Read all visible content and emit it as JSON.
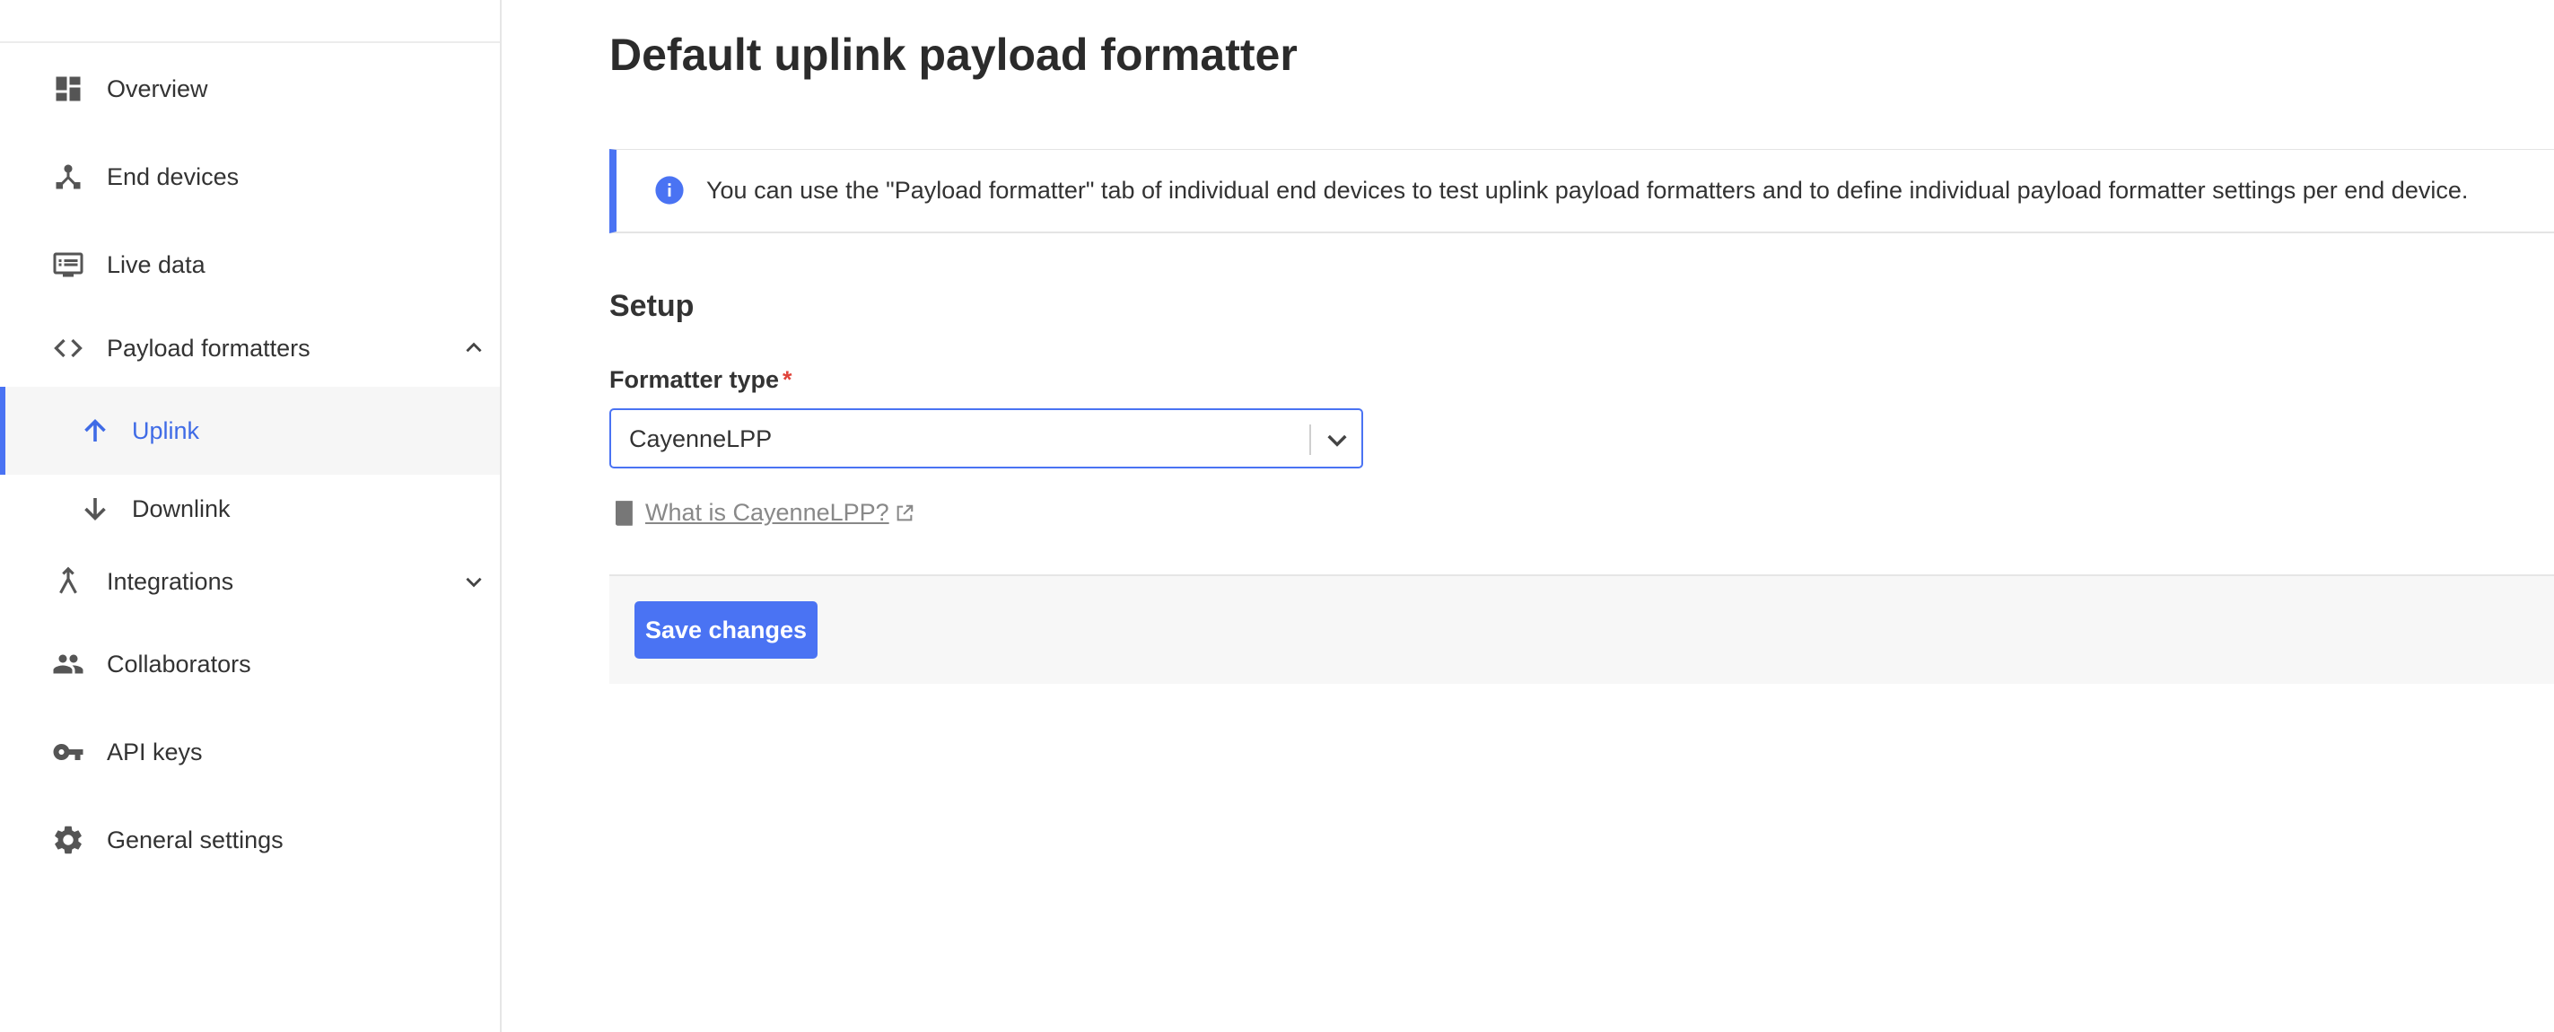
{
  "sidebar": {
    "items": [
      {
        "label": "Overview",
        "icon": "dashboard-icon"
      },
      {
        "label": "End devices",
        "icon": "device-hub-icon"
      },
      {
        "label": "Live data",
        "icon": "live-data-icon"
      },
      {
        "label": "Payload formatters",
        "icon": "code-icon",
        "expanded": true
      },
      {
        "label": "Uplink",
        "icon": "arrow-up-icon",
        "active": true
      },
      {
        "label": "Downlink",
        "icon": "arrow-down-icon"
      },
      {
        "label": "Integrations",
        "icon": "merge-icon",
        "expanded": false
      },
      {
        "label": "Collaborators",
        "icon": "people-icon"
      },
      {
        "label": "API keys",
        "icon": "key-icon"
      },
      {
        "label": "General settings",
        "icon": "gear-icon"
      }
    ]
  },
  "main": {
    "title": "Default uplink payload formatter",
    "notice": "You can use the \"Payload formatter\" tab of individual end devices to test uplink payload formatters and to define individual payload formatter settings per end device.",
    "setup_heading": "Setup",
    "formatter_label": "Formatter type",
    "required_mark": "*",
    "formatter_value": "CayenneLPP",
    "doc_link": "What is CayenneLPP?",
    "save_label": "Save changes"
  },
  "colors": {
    "accent": "#4a73f3",
    "active_text": "#3f6be6",
    "required": "#e0443b"
  }
}
